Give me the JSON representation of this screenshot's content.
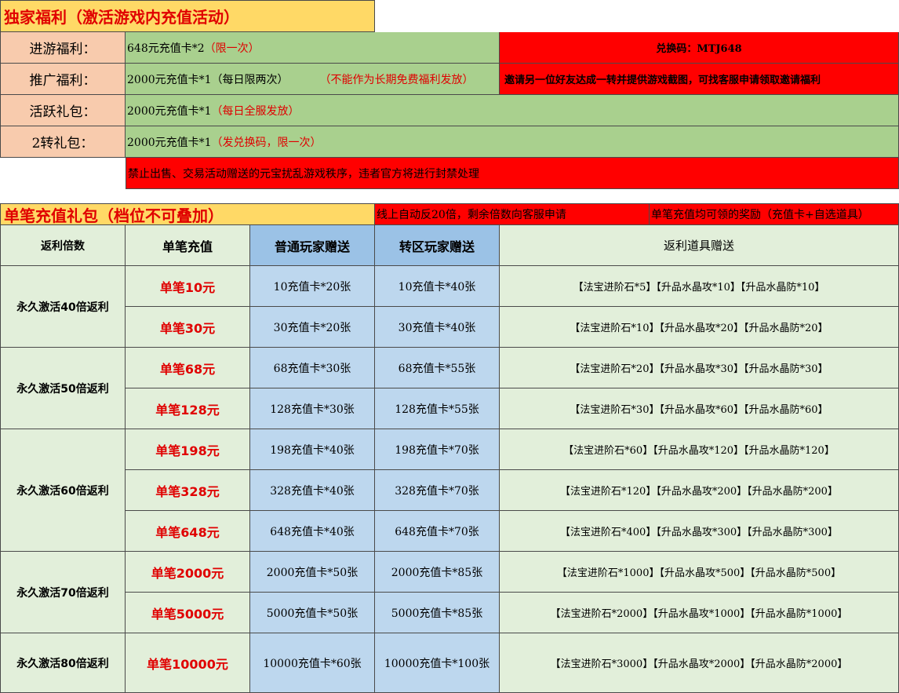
{
  "welfare": {
    "title": "独家福利（激活游戏内充值活动）",
    "rows": [
      {
        "label": "进游福利：",
        "content": "648元充值卡*2",
        "note": "（限一次）",
        "extra": "兑换码：MTJ648"
      },
      {
        "label": "推广福利：",
        "content": "2000元充值卡*1（每日限两次）",
        "note": "（不能作为长期免费福利发放）",
        "extra": "邀请另一位好友达成一转并提供游戏截图，可找客服申请领取邀请福利"
      },
      {
        "label": "活跃礼包：",
        "content": "2000元充值卡*1",
        "note": "（每日全服发放）"
      },
      {
        "label": "2转礼包：",
        "content": "2000元充值卡*1",
        "note": "（发兑换码，限一次）"
      }
    ],
    "warning": "禁止出售、交易活动赠送的元宝扰乱游戏秩序，违者官方将进行封禁处理"
  },
  "recharge": {
    "title": "单笔充值礼包（档位不可叠加）",
    "note1": "线上自动反20倍，剩余倍数向客服申请",
    "note2": "单笔充值均可领的奖励（充值卡+自选道具）",
    "headers": {
      "multiplier": "返利倍数",
      "single": "单笔充值",
      "normal": "普通玩家赠送",
      "transfer": "转区玩家赠送",
      "items": "返利道具赠送"
    },
    "groups": [
      {
        "label": "永久激活40倍返利",
        "rows": [
          {
            "amount": "单笔10元",
            "normal": "10充值卡*20张",
            "transfer": "10充值卡*40张",
            "items": "【法宝进阶石*5】【升品水晶攻*10】【升品水晶防*10】"
          },
          {
            "amount": "单笔30元",
            "normal": "30充值卡*20张",
            "transfer": "30充值卡*40张",
            "items": "【法宝进阶石*10】【升品水晶攻*20】【升品水晶防*20】"
          }
        ]
      },
      {
        "label": "永久激活50倍返利",
        "rows": [
          {
            "amount": "单笔68元",
            "normal": "68充值卡*30张",
            "transfer": "68充值卡*55张",
            "items": "【法宝进阶石*20】【升品水晶攻*30】【升品水晶防*30】"
          },
          {
            "amount": "单笔128元",
            "normal": "128充值卡*30张",
            "transfer": "128充值卡*55张",
            "items": "【法宝进阶石*30】【升品水晶攻*60】【升品水晶防*60】"
          }
        ]
      },
      {
        "label": "永久激活60倍返利",
        "rows": [
          {
            "amount": "单笔198元",
            "normal": "198充值卡*40张",
            "transfer": "198充值卡*70张",
            "items": "【法宝进阶石*60】【升品水晶攻*120】【升品水晶防*120】"
          },
          {
            "amount": "单笔328元",
            "normal": "328充值卡*40张",
            "transfer": "328充值卡*70张",
            "items": "【法宝进阶石*120】【升品水晶攻*200】【升品水晶防*200】"
          },
          {
            "amount": "单笔648元",
            "normal": "648充值卡*40张",
            "transfer": "648充值卡*70张",
            "items": "【法宝进阶石*400】【升品水晶攻*300】【升品水晶防*300】"
          }
        ]
      },
      {
        "label": "永久激活70倍返利",
        "rows": [
          {
            "amount": "单笔2000元",
            "normal": "2000充值卡*50张",
            "transfer": "2000充值卡*85张",
            "items": "【法宝进阶石*1000】【升品水晶攻*500】【升品水晶防*500】"
          },
          {
            "amount": "单笔5000元",
            "normal": "5000充值卡*50张",
            "transfer": "5000充值卡*85张",
            "items": "【法宝进阶石*2000】【升品水晶攻*1000】【升品水晶防*1000】"
          }
        ]
      },
      {
        "label": "永久激活80倍返利",
        "rows": [
          {
            "amount": "单笔10000元",
            "normal": "10000充值卡*60张",
            "transfer": "10000充值卡*100张",
            "items": "【法宝进阶石*3000】【升品水晶攻*2000】【升品水晶防*2000】"
          }
        ]
      }
    ]
  }
}
